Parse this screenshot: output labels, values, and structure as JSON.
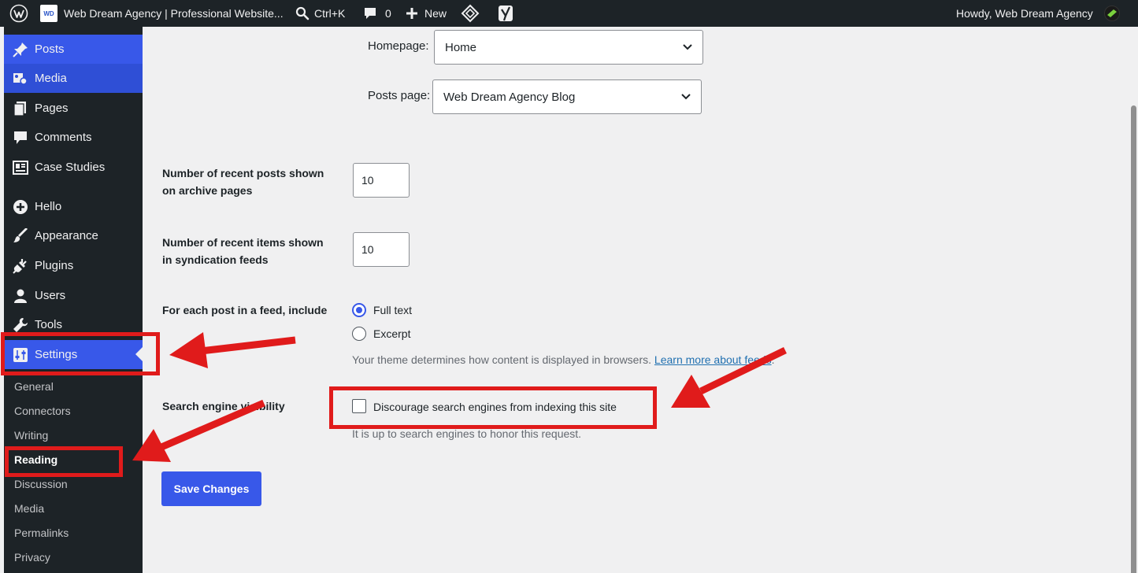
{
  "adminbar": {
    "site_name": "Web Dream Agency | Professional Website...",
    "site_logo_text": "WD",
    "search_shortcut": "Ctrl+K",
    "comments_count": "0",
    "new_label": "New",
    "greeting": "Howdy, Web Dream Agency"
  },
  "sidebar": {
    "items": [
      {
        "label": "Posts",
        "icon": "pushpin-icon"
      },
      {
        "label": "Media",
        "icon": "media-icon"
      },
      {
        "label": "Pages",
        "icon": "pages-icon"
      },
      {
        "label": "Comments",
        "icon": "comment-icon"
      },
      {
        "label": "Case Studies",
        "icon": "case-studies-icon"
      },
      {
        "label": "Hello",
        "icon": "plus-circle-icon"
      },
      {
        "label": "Appearance",
        "icon": "brush-icon"
      },
      {
        "label": "Plugins",
        "icon": "plug-icon"
      },
      {
        "label": "Users",
        "icon": "user-icon"
      },
      {
        "label": "Tools",
        "icon": "wrench-icon"
      },
      {
        "label": "Settings",
        "icon": "settings-icon"
      }
    ],
    "submenu": [
      "General",
      "Connectors",
      "Writing",
      "Reading",
      "Discussion",
      "Media",
      "Permalinks",
      "Privacy"
    ],
    "current_submenu": "Reading"
  },
  "form": {
    "homepage_label": "Homepage:",
    "homepage_value": "Home",
    "posts_page_label": "Posts page:",
    "posts_page_value": "Web Dream Agency Blog",
    "archive_posts_label_1": "Number of recent posts shown",
    "archive_posts_label_2": "on archive pages",
    "archive_posts_value": "10",
    "feed_items_label_1": "Number of recent items shown",
    "feed_items_label_2": "in syndication feeds",
    "feed_items_value": "10",
    "feed_include_label": "For each post in a feed, include",
    "full_text_label": "Full text",
    "excerpt_label": "Excerpt",
    "feed_desc": "Your theme determines how content is displayed in browsers.",
    "feed_desc_link": "Learn more about feeds",
    "feed_desc_end": ".",
    "visibility_label": "Search engine visibility",
    "visibility_checkbox_label": "Discourage search engines from indexing this site",
    "visibility_checked": false,
    "visibility_desc": "It is up to search engines to honor this request.",
    "save_label": "Save Changes"
  },
  "colors": {
    "admin_bg": "#1d2327",
    "accent": "#3858e9",
    "annotation_red": "#e01b1b"
  }
}
